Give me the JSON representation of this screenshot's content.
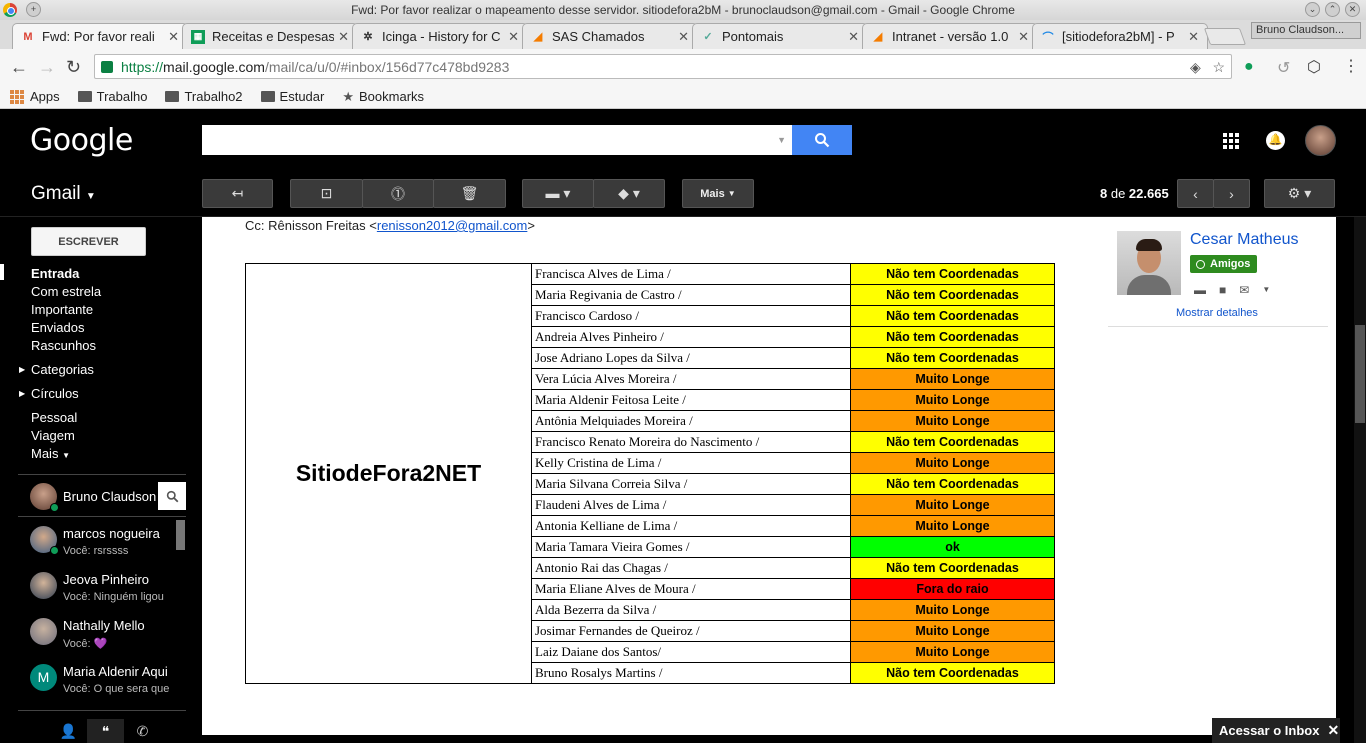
{
  "window": {
    "title": "Fwd: Por favor realizar o mapeamento desse servidor. sitiodefora2bM - brunoclaudson@gmail.com - Gmail - Google Chrome"
  },
  "tabs": [
    {
      "label": "Fwd: Por favor reali",
      "icon": "gmail-icon",
      "active": true
    },
    {
      "label": "Receitas e Despesas",
      "icon": "sheets-icon",
      "active": false
    },
    {
      "label": "Icinga - History for C",
      "icon": "icinga-icon",
      "active": false
    },
    {
      "label": "SAS Chamados",
      "icon": "sas-icon",
      "active": false
    },
    {
      "label": "Pontomais",
      "icon": "check-icon",
      "active": false
    },
    {
      "label": "Intranet - versão 1.0",
      "icon": "sas-icon",
      "active": false
    },
    {
      "label": "[sitiodefora2bM] - P",
      "icon": "rss-icon",
      "active": false
    }
  ],
  "profile": "Bruno Claudson...",
  "url": {
    "protocol": "https://",
    "host": "mail.google.com",
    "path": "/mail/ca/u/0/#inbox/156d77c478bd9283"
  },
  "bookmarks": [
    {
      "label": "Apps",
      "icon": "apps-icon"
    },
    {
      "label": "Trabalho",
      "icon": "folder-icon"
    },
    {
      "label": "Trabalho2",
      "icon": "folder-icon"
    },
    {
      "label": "Estudar",
      "icon": "folder-icon"
    },
    {
      "label": "Bookmarks",
      "icon": "star-icon"
    }
  ],
  "gmail": {
    "logo": "Google",
    "product": "Gmail",
    "toolbar": {
      "more_label": "Mais",
      "pager_prefix": "8",
      "pager_middle": " de ",
      "pager_total": "22.665"
    },
    "compose_label": "ESCREVER",
    "nav": {
      "inbox": "Entrada",
      "starred": "Com estrela",
      "important": "Importante",
      "sent": "Enviados",
      "drafts": "Rascunhos",
      "categories": "Categorias",
      "circles": "Círculos",
      "personal": "Pessoal",
      "travel": "Viagem",
      "more": "Mais"
    },
    "hangouts": {
      "me": "Bruno Claudson",
      "contacts": [
        {
          "name": "marcos nogueira",
          "message": "Você: rsrssss",
          "avatar_color": "#8a6a55",
          "online": true
        },
        {
          "name": "Jeova Pinheiro",
          "message": "Você: Ninguém ligou",
          "avatar_color": "#6d5a4a",
          "online": false
        },
        {
          "name": "Nathally Mello",
          "message": "Você:  💜",
          "avatar_color": "#9a8a80",
          "online": false
        },
        {
          "name": "Maria Aldenir Aqui",
          "message": "Você: O que sera que",
          "avatar_color": "#00897b",
          "initial": "M",
          "online": false
        }
      ]
    },
    "accessinbox": "Acessar o Inbox"
  },
  "message": {
    "cc_label": "Cc: Rênisson Freitas <",
    "cc_email": "renisson2012@gmail.com",
    "cc_suffix": ">",
    "site": "SitiodeFora2NET",
    "rows": [
      {
        "name": "Francisca Alves de Lima /",
        "status": "Não tem Coordenadas",
        "color": "#ffff00"
      },
      {
        "name": "Maria Regivania de Castro /",
        "status": "Não tem Coordenadas",
        "color": "#ffff00"
      },
      {
        "name": "Francisco Cardoso /",
        "status": "Não tem Coordenadas",
        "color": "#ffff00"
      },
      {
        "name": "Andreia Alves Pinheiro /",
        "status": "Não tem Coordenadas",
        "color": "#ffff00"
      },
      {
        "name": "Jose Adriano Lopes da Silva /",
        "status": "Não tem Coordenadas",
        "color": "#ffff00"
      },
      {
        "name": "Vera Lúcia Alves Moreira /",
        "status": "Muito Longe",
        "color": "#ff9900"
      },
      {
        "name": "Maria Aldenir Feitosa Leite /",
        "status": "Muito Longe",
        "color": "#ff9900"
      },
      {
        "name": "Antônia Melquiades Moreira /",
        "status": "Muito Longe",
        "color": "#ff9900"
      },
      {
        "name": "Francisco Renato Moreira do Nascimento /",
        "status": "Não tem Coordenadas",
        "color": "#ffff00"
      },
      {
        "name": "Kelly Cristina de Lima /",
        "status": "Muito Longe",
        "color": "#ff9900"
      },
      {
        "name": "Maria Silvana Correia Silva /",
        "status": "Não tem Coordenadas",
        "color": "#ffff00"
      },
      {
        "name": "Flaudeni Alves de Lima /",
        "status": "Muito Longe",
        "color": "#ff9900"
      },
      {
        "name": "Antonia Kelliane de Lima /",
        "status": "Muito Longe",
        "color": "#ff9900"
      },
      {
        "name": "Maria Tamara Vieira Gomes /",
        "status": "ok",
        "color": "#00ff00"
      },
      {
        "name": "Antonio Rai das Chagas /",
        "status": "Não tem Coordenadas",
        "color": "#ffff00"
      },
      {
        "name": "Maria Eliane Alves de Moura /",
        "status": "Fora do raio",
        "color": "#ff0000"
      },
      {
        "name": "Alda Bezerra da Silva /",
        "status": "Muito Longe",
        "color": "#ff9900"
      },
      {
        "name": "Josimar Fernandes de Queiroz /",
        "status": "Muito Longe",
        "color": "#ff9900"
      },
      {
        "name": "Laiz Daiane dos Santos/",
        "status": "Muito Longe",
        "color": "#ff9900"
      },
      {
        "name": "Bruno Rosalys Martins /",
        "status": "Não tem Coordenadas",
        "color": "#ffff00"
      }
    ]
  },
  "contact_card": {
    "name": "Cesar Matheus",
    "badge": "Amigos",
    "details_link": "Mostrar detalhes"
  }
}
